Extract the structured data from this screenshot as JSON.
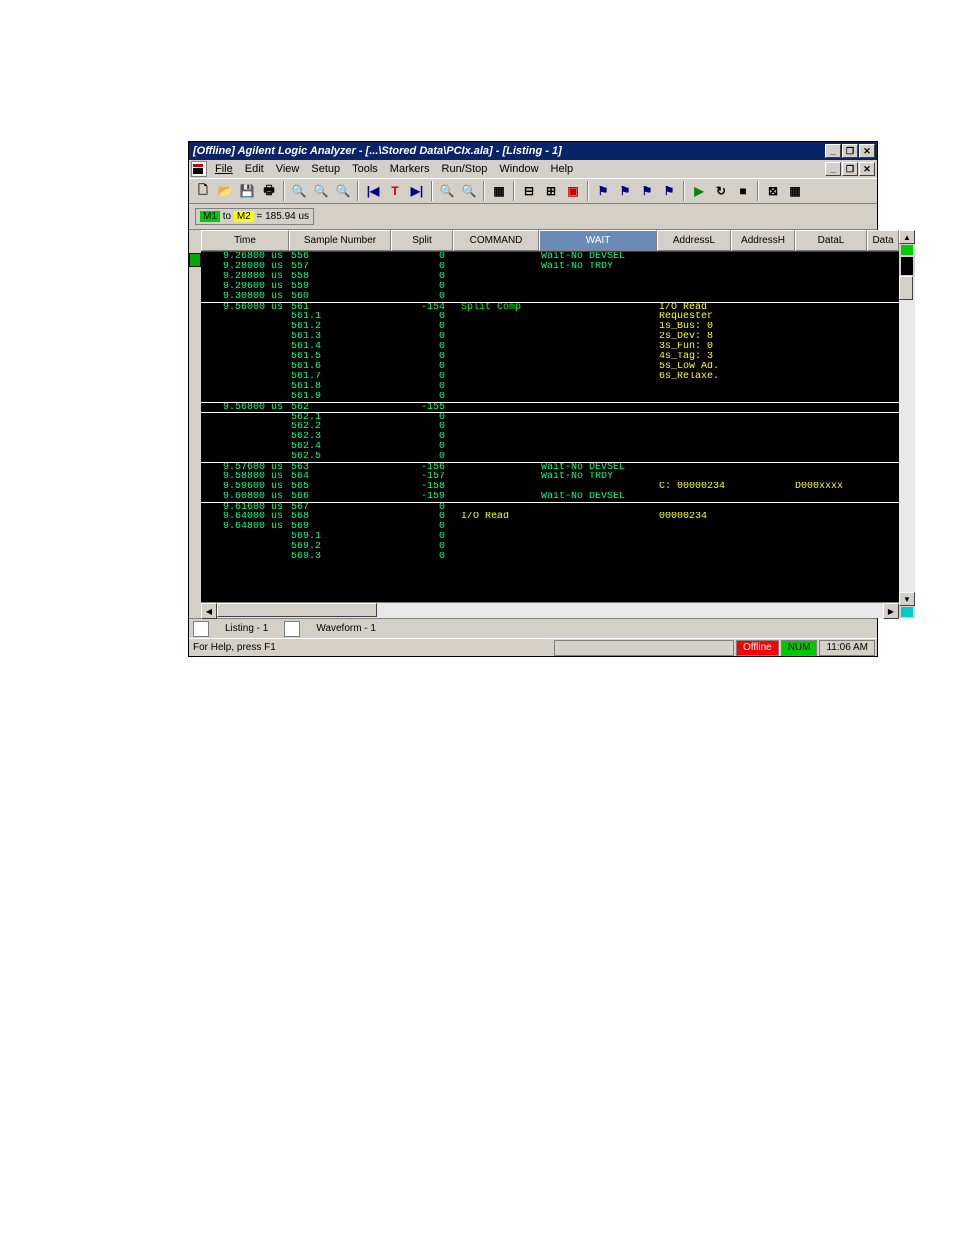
{
  "titlebar": "[Offline] Agilent Logic Analyzer  - [...\\Stored Data\\PCIx.ala] - [Listing - 1]",
  "window_buttons": {
    "min": "_",
    "max": "❐",
    "close": "✕"
  },
  "child_buttons": {
    "min": "_",
    "max": "❐",
    "close": "✕"
  },
  "menus": [
    "File",
    "Edit",
    "View",
    "Setup",
    "Tools",
    "Markers",
    "Run/Stop",
    "Window",
    "Help"
  ],
  "marker_text": {
    "m1": "M1",
    "to": "to",
    "m2": "M2",
    "val": "= 185.94 us"
  },
  "columns": [
    "Time",
    "Sample Number",
    "Split",
    "COMMAND",
    "WAIT",
    "AddressL",
    "AddressH",
    "DataL",
    "Data"
  ],
  "rows": [
    {
      "time": "9.26800 us",
      "sample": "556",
      "split": "0",
      "cmd": "",
      "wait": "Wait-No DEVSEL",
      "addrl": "",
      "datal": "",
      "sep": false
    },
    {
      "time": "9.28000 us",
      "sample": "557",
      "split": "0",
      "cmd": "",
      "wait": "Wait-No TRDY",
      "addrl": "",
      "datal": "",
      "sep": false
    },
    {
      "time": "9.28800 us",
      "sample": "558",
      "split": "0",
      "cmd": "",
      "wait": "",
      "addrl": "",
      "datal": "",
      "sep": false
    },
    {
      "time": "9.29600 us",
      "sample": "559",
      "split": "0",
      "cmd": "",
      "wait": "",
      "addrl": "",
      "datal": "",
      "sep": false
    },
    {
      "time": "9.30800 us",
      "sample": "560",
      "split": "0",
      "cmd": "",
      "wait": "",
      "addrl": "",
      "datal": "",
      "sep": false
    },
    {
      "time": "9.56000 us",
      "sample": "561",
      "split": "-154",
      "cmd": "Split Comp",
      "wait": "",
      "addrl": "I/O Read",
      "datal": "",
      "sep": true,
      "cmdColor": "green2",
      "addrColor": "yellow"
    },
    {
      "time": "",
      "sample": "561.1",
      "split": "0",
      "cmd": "",
      "wait": "",
      "addrl": "Requester",
      "datal": "",
      "sep": false,
      "addrColor": "yellow"
    },
    {
      "time": "",
      "sample": "561.2",
      "split": "0",
      "cmd": "",
      "wait": "",
      "addrl": "  1s_Bus: 0",
      "datal": "",
      "sep": false,
      "addrColor": "yellow"
    },
    {
      "time": "",
      "sample": "561.3",
      "split": "0",
      "cmd": "",
      "wait": "",
      "addrl": "  2s_Dev: 8",
      "datal": "",
      "sep": false,
      "addrColor": "yellow"
    },
    {
      "time": "",
      "sample": "561.4",
      "split": "0",
      "cmd": "",
      "wait": "",
      "addrl": "  3s_Fun: 0",
      "datal": "",
      "sep": false,
      "addrColor": "yellow"
    },
    {
      "time": "",
      "sample": "561.5",
      "split": "0",
      "cmd": "",
      "wait": "",
      "addrl": "  4s_Tag: 3",
      "datal": "",
      "sep": false,
      "addrColor": "yellow"
    },
    {
      "time": "",
      "sample": "561.6",
      "split": "0",
      "cmd": "",
      "wait": "",
      "addrl": "  5s_Low Ad.",
      "datal": "",
      "sep": false,
      "addrColor": "yellow"
    },
    {
      "time": "",
      "sample": "561.7",
      "split": "0",
      "cmd": "",
      "wait": "",
      "addrl": "  6s_Relaxe.",
      "datal": "",
      "sep": false,
      "addrColor": "yellow"
    },
    {
      "time": "",
      "sample": "561.8",
      "split": "0",
      "cmd": "",
      "wait": "",
      "addrl": "",
      "datal": "",
      "sep": false
    },
    {
      "time": "",
      "sample": "561.9",
      "split": "0",
      "cmd": "",
      "wait": "",
      "addrl": "",
      "datal": "",
      "sep": false
    },
    {
      "time": "9.56800 us",
      "sample": "562",
      "split": "-155",
      "cmd": "",
      "wait": "",
      "addrl": "",
      "datal": "",
      "sep": true
    },
    {
      "time": "",
      "sample": "562.1",
      "split": "0",
      "cmd": "",
      "wait": "",
      "addrl": "",
      "datal": "",
      "sep": true
    },
    {
      "time": "",
      "sample": "562.2",
      "split": "0",
      "cmd": "",
      "wait": "",
      "addrl": "",
      "datal": "",
      "sep": false
    },
    {
      "time": "",
      "sample": "562.3",
      "split": "0",
      "cmd": "",
      "wait": "",
      "addrl": "",
      "datal": "",
      "sep": false
    },
    {
      "time": "",
      "sample": "562.4",
      "split": "0",
      "cmd": "",
      "wait": "",
      "addrl": "",
      "datal": "",
      "sep": false
    },
    {
      "time": "",
      "sample": "562.5",
      "split": "0",
      "cmd": "",
      "wait": "",
      "addrl": "",
      "datal": "",
      "sep": false
    },
    {
      "time": "9.57600 us",
      "sample": "563",
      "split": "-156",
      "cmd": "",
      "wait": "Wait-No DEVSEL",
      "addrl": "",
      "datal": "",
      "sep": true
    },
    {
      "time": "9.58800 us",
      "sample": "564",
      "split": "-157",
      "cmd": "",
      "wait": "Wait-No TRDY",
      "addrl": "",
      "datal": "",
      "sep": false
    },
    {
      "time": "9.59600 us",
      "sample": "565",
      "split": "-158",
      "cmd": "",
      "wait": "",
      "addrl": "C: 00000234",
      "datal": "D000xxxx",
      "sep": false,
      "addrColor": "yellow",
      "dataColor": "yellow"
    },
    {
      "time": "9.60800 us",
      "sample": "566",
      "split": "-159",
      "cmd": "",
      "wait": "Wait-No DEVSEL",
      "addrl": "",
      "datal": "",
      "sep": false
    },
    {
      "time": "9.61600 us",
      "sample": "567",
      "split": "0",
      "cmd": "",
      "wait": "",
      "addrl": "",
      "datal": "",
      "sep": true
    },
    {
      "time": "9.64000 us",
      "sample": "568",
      "split": "0",
      "cmd": "I/O Read",
      "wait": "",
      "addrl": "00000234",
      "datal": "",
      "sep": false,
      "cmdColor": "yellow",
      "addrColor": "yellow"
    },
    {
      "time": "9.64800 us",
      "sample": "569",
      "split": "0",
      "cmd": "",
      "wait": "",
      "addrl": "",
      "datal": "",
      "sep": false
    },
    {
      "time": "",
      "sample": "569.1",
      "split": "0",
      "cmd": "",
      "wait": "",
      "addrl": "",
      "datal": "",
      "sep": false
    },
    {
      "time": "",
      "sample": "569.2",
      "split": "0",
      "cmd": "",
      "wait": "",
      "addrl": "",
      "datal": "",
      "sep": false
    },
    {
      "time": "",
      "sample": "569.3",
      "split": "0",
      "cmd": "",
      "wait": "",
      "addrl": "",
      "datal": "",
      "sep": false
    }
  ],
  "tabs": [
    {
      "label": "Listing - 1"
    },
    {
      "label": "Waveform - 1"
    }
  ],
  "statusbar": {
    "help": "For Help, press F1",
    "offline": "Offline",
    "num": "NUM",
    "time": "11:06 AM"
  }
}
